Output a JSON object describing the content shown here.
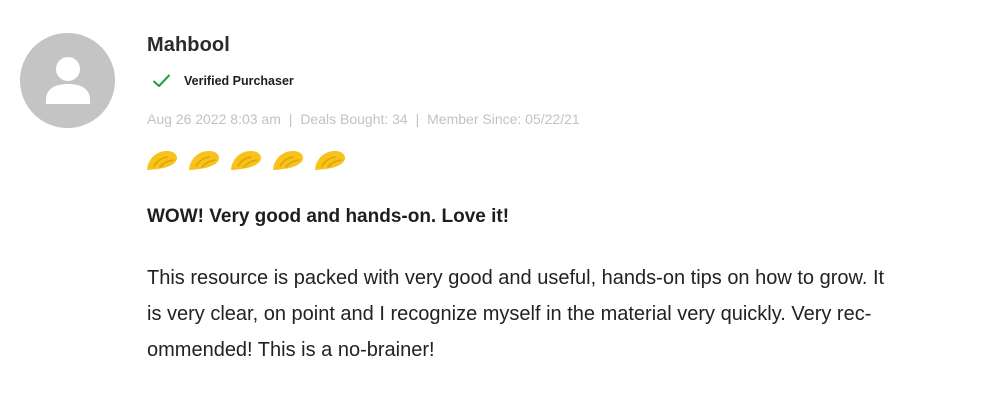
{
  "review": {
    "author": "Mahbool",
    "verified_label": "Verified Purchaser",
    "meta": {
      "date": "Aug 26 2022 8:03 am",
      "deals_bought": "Deals Bought: 34",
      "member_since": "Member Since: 05/22/21",
      "separator": "|"
    },
    "rating": 5,
    "rating_icon": "taco-icon",
    "title": "WOW! Very good and hands-on. Love it!",
    "body_lines": [
      "This resource is packed with very good and useful, hands-on tips on how to grow. It",
      "is very clear, on point and I recognize myself in the material very quickly. Very rec-",
      "ommended! This is a no-brainer!"
    ]
  },
  "colors": {
    "avatar_bg": "#c4c4c4",
    "verified_check": "#1aa33c",
    "meta_text": "#c2c2c2",
    "taco_fill": "#f7c21b",
    "taco_shade": "#e0a400"
  }
}
